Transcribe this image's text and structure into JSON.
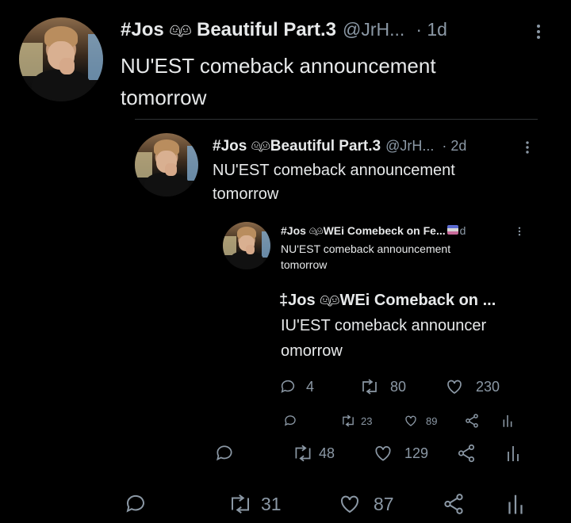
{
  "tweet1": {
    "name": "#Jos 👩‍❤️‍👨 Beautiful Part.3",
    "name_short": "#Jos",
    "name_rest": "Beautiful Part.3",
    "handle": "@JrH...",
    "time": "· 1d",
    "text": "NU'EST comeback announcement tomorrow",
    "replies": "",
    "retweets": "31",
    "likes": "87"
  },
  "tweet2": {
    "name_short": "#Jos",
    "name_rest": "Beautiful Part.3",
    "handle": "@JrH...",
    "time": "· 2d",
    "text": "NU'EST comeback announcement tomorrow",
    "retweets": "48",
    "likes": "129"
  },
  "tweet3": {
    "name_short": "#Jos",
    "name_rest": "WEi Comebeck on Fe...",
    "time_suffix": "d",
    "text": "NU'EST comeback announcement tomorrow",
    "retweets": "23",
    "likes": "89"
  },
  "tweet4": {
    "name_short": "‡Jos",
    "name_rest": "WEi Comeback on ...",
    "text_line1": "IU'EST comeback announcer",
    "text_line2": "omorrow",
    "replies": "4",
    "retweets": "80",
    "likes": "230"
  },
  "colors": {
    "background": "#000000",
    "text": "#e7e9ea",
    "muted": "#8b98a5",
    "divider": "#2f3336"
  },
  "icons": [
    "reply-icon",
    "retweet-icon",
    "like-icon",
    "share-icon",
    "analytics-icon",
    "more-icon",
    "couple-emoji-icon",
    "flag-emoji-icon"
  ]
}
